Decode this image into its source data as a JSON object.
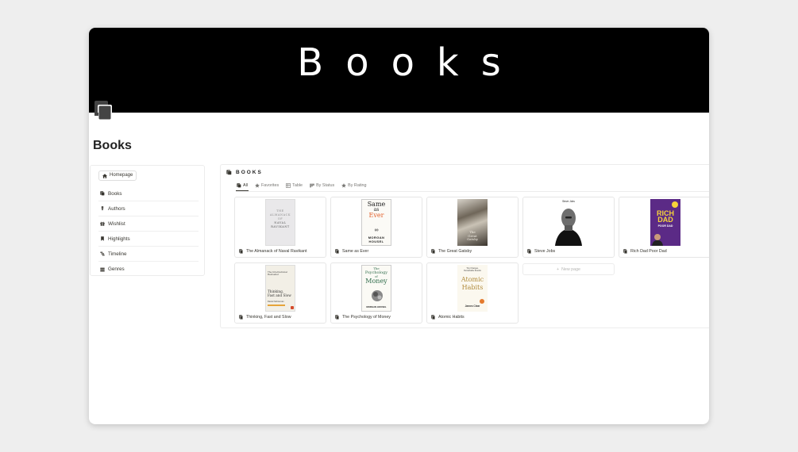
{
  "cover": {
    "title": "Books"
  },
  "page": {
    "title": "Books"
  },
  "sidebar": {
    "home": "Homepage",
    "items": [
      {
        "label": "Books",
        "icon": "book-icon"
      },
      {
        "label": "Authors",
        "icon": "pen-icon"
      },
      {
        "label": "Wishlist",
        "icon": "gift-icon"
      },
      {
        "label": "Highlights",
        "icon": "bookmark-icon"
      },
      {
        "label": "Timeline",
        "icon": "timeline-icon"
      },
      {
        "label": "Genres",
        "icon": "stack-icon"
      }
    ]
  },
  "database": {
    "title": "BOOKS",
    "tabs": [
      {
        "label": "All",
        "icon": "book-icon",
        "active": true
      },
      {
        "label": "Favorites",
        "icon": "star-icon"
      },
      {
        "label": "Table",
        "icon": "table-icon"
      },
      {
        "label": "By Status",
        "icon": "board-icon"
      },
      {
        "label": "By Rating",
        "icon": "star-icon"
      }
    ],
    "cards": [
      {
        "title": "The Almanack of Naval Ravikant",
        "cover_lines": [
          "THE",
          "ALMANACK",
          "OF",
          "NAVAL",
          "RAVIKANT"
        ]
      },
      {
        "title": "Same as Ever",
        "cover_lines": [
          "Same",
          "as",
          "Ever",
          "MORGAN",
          "HOUSEL"
        ]
      },
      {
        "title": "The Great Gatsby",
        "cover_lines": [
          "The",
          "Great",
          "Gatsby"
        ]
      },
      {
        "title": "Steve Jobs",
        "cover_lines": [
          "Steve Jobs"
        ]
      },
      {
        "title": "Rich Dad Poor Dad",
        "cover_lines": [
          "RICH",
          "DAD",
          "POOR DAD"
        ]
      },
      {
        "title": "Thinking, Fast and Slow",
        "cover_lines": [
          "The International",
          "Bestseller",
          "Thinking,",
          "Fast and Slow",
          "Daniel Kahneman"
        ]
      },
      {
        "title": "The Psychology of Money",
        "cover_lines": [
          "The",
          "Psychology",
          "of",
          "Money",
          "MORGAN HOUSEL"
        ]
      },
      {
        "title": "Atomic Habits",
        "cover_lines": [
          "Tiny Changes,",
          "Remarkable Results",
          "Atomic",
          "Habits",
          "James Clear"
        ]
      }
    ],
    "new_page": "New page"
  }
}
